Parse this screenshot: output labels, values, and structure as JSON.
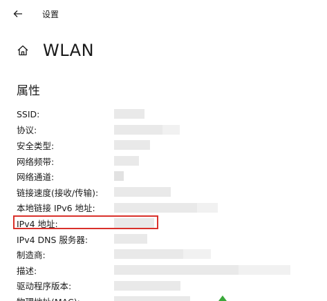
{
  "window": {
    "title": "设置"
  },
  "header": {
    "title": "WLAN"
  },
  "properties": {
    "section_title": "属性",
    "items": [
      {
        "label": "SSID:"
      },
      {
        "label": "协议:"
      },
      {
        "label": "安全类型:"
      },
      {
        "label": "网络频带:"
      },
      {
        "label": "网络通道:"
      },
      {
        "label": "链接速度(接收/传输):"
      },
      {
        "label": "本地链接 IPv6 地址:"
      },
      {
        "label": "IPv4 地址:"
      },
      {
        "label": "IPv4 DNS 服务器:"
      },
      {
        "label": "制造商:"
      },
      {
        "label": "描述:"
      },
      {
        "label": "驱动程序版本:"
      },
      {
        "label": "物理地址(MAC):"
      }
    ]
  },
  "highlight": {
    "color": "#d9302a",
    "target_label": "IPv4 地址:"
  },
  "icons": {
    "back": "back-arrow-icon",
    "home": "home-icon"
  }
}
